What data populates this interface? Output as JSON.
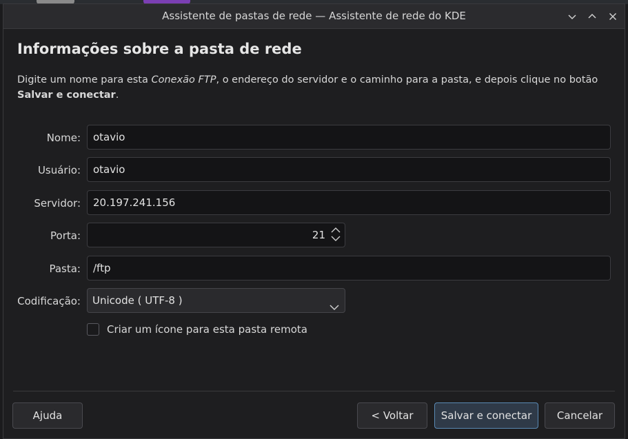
{
  "window": {
    "title": "Assistente de pastas de rede — Assistente de rede do KDE",
    "controls": {
      "minimize_icon": "chevron-down-icon",
      "maximize_icon": "chevron-up-icon",
      "close_icon": "close-icon"
    }
  },
  "heading": "Informações sobre a pasta de rede",
  "intro": {
    "part1": "Digite um nome para esta ",
    "italic": "Conexão FTP",
    "part2": ", o endereço do servidor e o caminho para a pasta, e depois clique no botão ",
    "bold": "Salvar e conectar",
    "part3": "."
  },
  "form": {
    "name_label": "Nome:",
    "name_value": "otavio",
    "user_label": "Usuário:",
    "user_value": "otavio",
    "server_label": "Servidor:",
    "server_value": "20.197.241.156",
    "port_label": "Porta:",
    "port_value": "21",
    "folder_label": "Pasta:",
    "folder_value": "/ftp",
    "encoding_label": "Codificação:",
    "encoding_value": "Unicode ( UTF-8 )",
    "icon_checkbox_label": "Criar um ícone para esta pasta remota",
    "icon_checkbox_checked": false
  },
  "buttons": {
    "help": "Ajuda",
    "back": "< Voltar",
    "save_connect": "Salvar e conectar",
    "cancel": "Cancelar"
  },
  "colors": {
    "accent": "#5a8ab5",
    "background": "#1e1e20"
  }
}
